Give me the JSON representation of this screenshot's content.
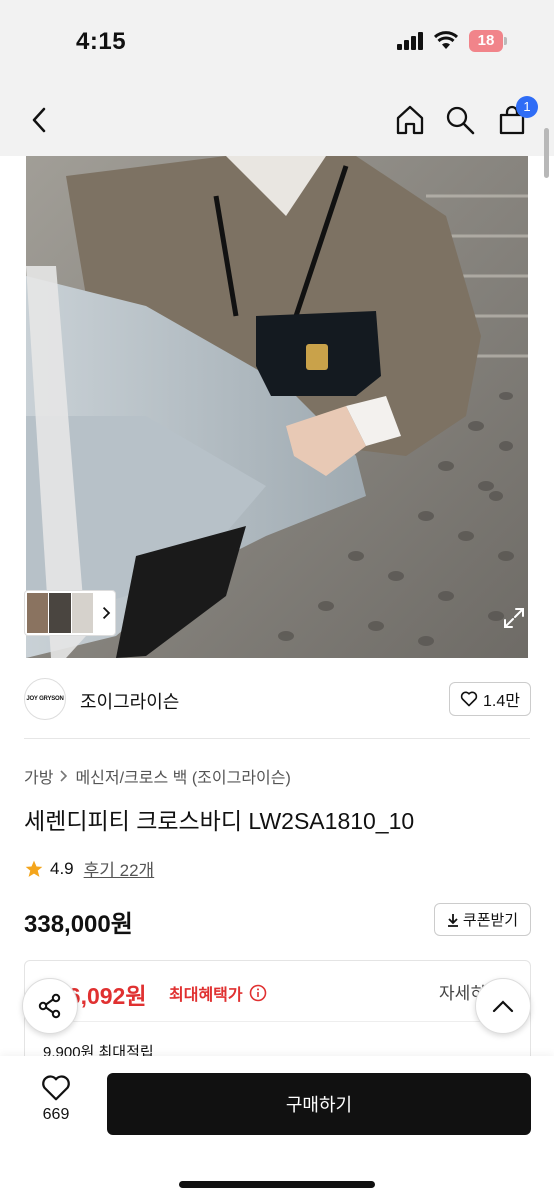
{
  "status_bar": {
    "time": "4:15",
    "battery": "18",
    "icons": [
      "signal-icon",
      "wifi-icon",
      "battery-icon"
    ]
  },
  "nav": {
    "icons": [
      "back-icon",
      "home-icon",
      "search-icon",
      "cart-icon"
    ],
    "cart_badge": "1",
    "badge_color": "#2f6df6"
  },
  "brand": {
    "logo_text": "JOY GRYSON",
    "name": "조이그라이슨",
    "like_count": "1.4만"
  },
  "breadcrumb": {
    "category": "가방",
    "subcategory": "메신저/크로스 백 (조이그라이슨)"
  },
  "product": {
    "title": "세렌디피티 크로스바디 LW2SA1810_10",
    "rating": "4.9",
    "reviews": "후기 22개",
    "price": "338,000원",
    "coupon_label": "쿠폰받기"
  },
  "benefit": {
    "max_price": "96,092원",
    "max_label": "최대혜택가",
    "detail_label": "자세히",
    "points": "9,900원 최대적립",
    "accent": "#e03131"
  },
  "bottom": {
    "wish_count": "669",
    "buy_label": "구매하기"
  }
}
